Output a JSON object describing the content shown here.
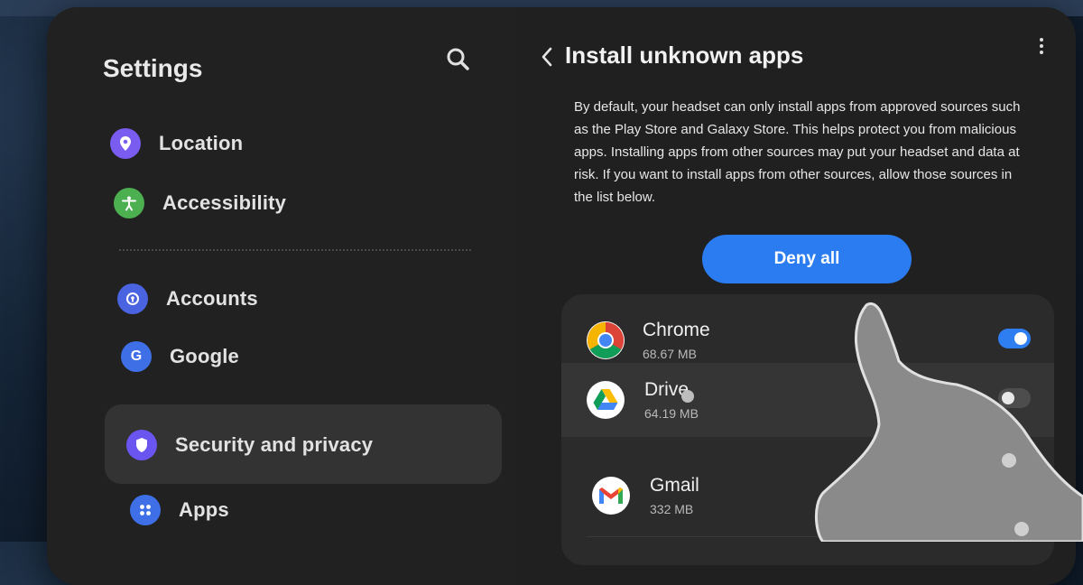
{
  "settings": {
    "title": "Settings",
    "nav": {
      "location": "Location",
      "accessibility": "Accessibility",
      "accounts": "Accounts",
      "google": "Google",
      "security": "Security and privacy",
      "apps": "Apps"
    },
    "icons": {
      "location": "location-pin-icon",
      "accessibility": "accessibility-person-icon",
      "accounts": "account-key-icon",
      "google": "google-g-icon",
      "security": "shield-icon",
      "apps": "apps-grid-icon"
    },
    "icon_colors": {
      "location": "#7a5cf0",
      "accessibility": "#4caf50",
      "accounts": "#4a63e0",
      "google": "#3f6fe6",
      "security": "#6a55f0",
      "apps": "#3f6fe6"
    }
  },
  "page": {
    "title": "Install unknown apps",
    "description": "By default, your headset can only install apps from approved sources such as the Play Store and Galaxy Store. This helps protect you from malicious apps. Installing apps from other sources may put your headset and data at risk. If you want to install apps from other sources, allow those sources in the list below.",
    "deny_all": "Deny all",
    "accent": "#2b7cf0"
  },
  "apps": [
    {
      "name": "Chrome",
      "size": "68.67 MB",
      "enabled": true,
      "icon": "chrome-icon"
    },
    {
      "name": "Drive",
      "size": "64.19 MB",
      "enabled": false,
      "icon": "google-drive-icon"
    },
    {
      "name": "Gmail",
      "size": "332 MB",
      "enabled": false,
      "icon": "gmail-icon"
    }
  ]
}
